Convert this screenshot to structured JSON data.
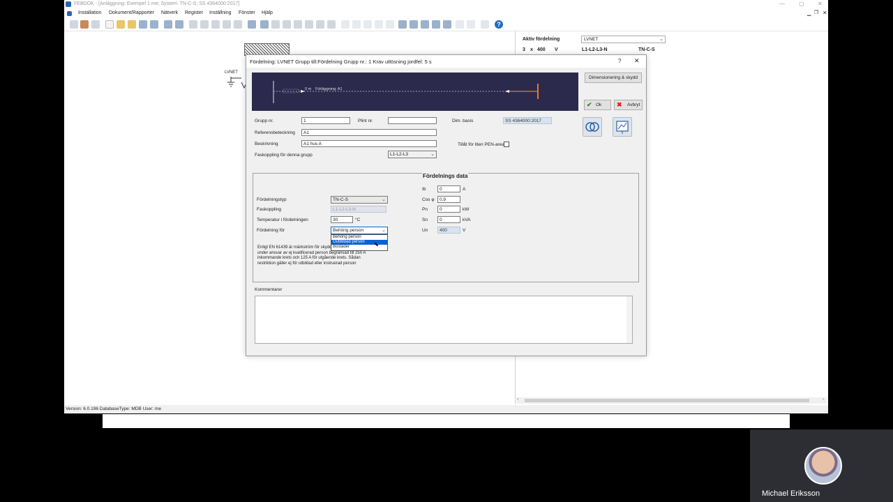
{
  "app": {
    "title": "FEBDOK - [Anläggning: Exempel 1 me; System: TN-C-S; SS 4364000:2017]",
    "menu": [
      "Installation",
      "Dokument/Rapporter",
      "Nätverk",
      "Register",
      "Inställning",
      "Fönster",
      "Hjälp"
    ],
    "status_text": "Version: 6.0.196 DatabaseType: MDB   User: me",
    "canvas_label": "LVNET"
  },
  "info_panel": {
    "active_label": "Aktiv fördelning",
    "active_value": "LVNET",
    "phase_count": "3",
    "x": "x",
    "voltage": "400",
    "voltage_unit": "V",
    "phases": "L1-L2-L3-N",
    "system": "TN-C-S"
  },
  "dialog": {
    "title": "Fördelning: LVNET     Grupp till:Fördelning     Grupp nr.: 1    Krav utlösning jordfel: 5 s",
    "help": "?",
    "close": "✕",
    "banner": {
      "distance": "0 m",
      "label": "Förläggning: A1"
    },
    "dim_button": "Dimensionering & skydd",
    "ok": "Ok",
    "cancel": "Avbryt",
    "grupp_nr_label": "Grupp nr.",
    "grupp_nr_value": "1",
    "plint_label": "Plint nr.",
    "plint_value": "",
    "dim_basis_label": "Dim. basis",
    "dim_basis_value": "SS 4364000:2017",
    "ref_label": "Referensbeteckning",
    "ref_value": "A1",
    "desc_label": "Beskrivning",
    "desc_value": "A1 hus A",
    "pen_label": "Tillåt för liten PEN-area",
    "fas_label": "Faskoppling för denna grupp",
    "fas_value": "L1-L2-L3",
    "section_title": "Fördelnings data",
    "typ_label": "Fördelningstyp",
    "typ_value": "TN-C-S",
    "faskoppling_label": "Faskoppling",
    "faskoppling_value": "L1-L2-L3-N",
    "temp_label": "Temperatur i fördelningen",
    "temp_value": "30",
    "temp_unit": "°C",
    "for_label": "Fördelning för",
    "for_value": "Behörig person",
    "dropdown_options": [
      "Behörig person",
      "Outbildad person",
      "Bostäder"
    ],
    "note_lines": [
      "Enligt EN 61439 är märkström för skydd",
      "under ansvar av ej kvalificerad person begränsad till 250 A",
      "inkommande krets och 125 A för utgående krets. Sådan",
      "restriktion gäller ej för utbildad eller instruerad person"
    ],
    "ib_label": "Ib",
    "ib_value": "0",
    "ib_unit": "A",
    "cos_label": "Cos φ",
    "cos_value": "0,9",
    "pn_label": "Pn",
    "pn_value": "0",
    "pn_unit": "kW",
    "sn_label": "Sn",
    "sn_value": "0",
    "sn_unit": "kVA",
    "un_label": "Un",
    "un_value": "400",
    "un_unit": "V",
    "comment_label": "Kommentarer"
  },
  "participant": {
    "name": "Michael Eriksson"
  },
  "colors": {
    "banner": "#2b2a4c",
    "accent": "#0a61d8",
    "cable": "#e07a3c"
  }
}
